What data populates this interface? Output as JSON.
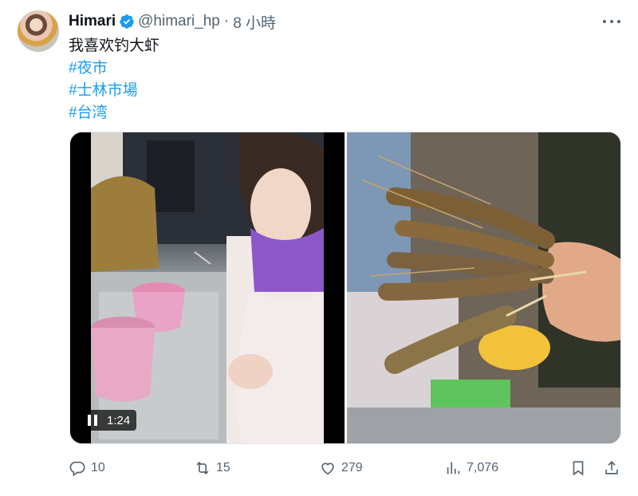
{
  "author": {
    "name": "Himari",
    "handle": "@himari_hp",
    "separator": "·",
    "time": "8 小時",
    "avatar_icon": "avatar-photo",
    "verified_color": "#1d9bf0"
  },
  "tweet": {
    "text": "我喜欢钓大虾",
    "hashtags": [
      "#夜市",
      "#士林市場",
      "#台湾"
    ],
    "hashtag_color": "#1d9bf0"
  },
  "media": {
    "left": {
      "type": "video",
      "duration": "1:24",
      "control_icon": "pause-icon"
    },
    "right": {
      "type": "image"
    }
  },
  "actions": {
    "reply": {
      "icon": "reply-icon",
      "count": "10"
    },
    "retweet": {
      "icon": "retweet-icon",
      "count": "15"
    },
    "like": {
      "icon": "heart-icon",
      "count": "279"
    },
    "views": {
      "icon": "views-chart-icon",
      "count": "7,076"
    },
    "bookmark": {
      "icon": "bookmark-icon"
    },
    "share": {
      "icon": "share-icon"
    }
  },
  "colors": {
    "text": "#0f1419",
    "secondary": "#536471",
    "accent": "#1d9bf0"
  }
}
